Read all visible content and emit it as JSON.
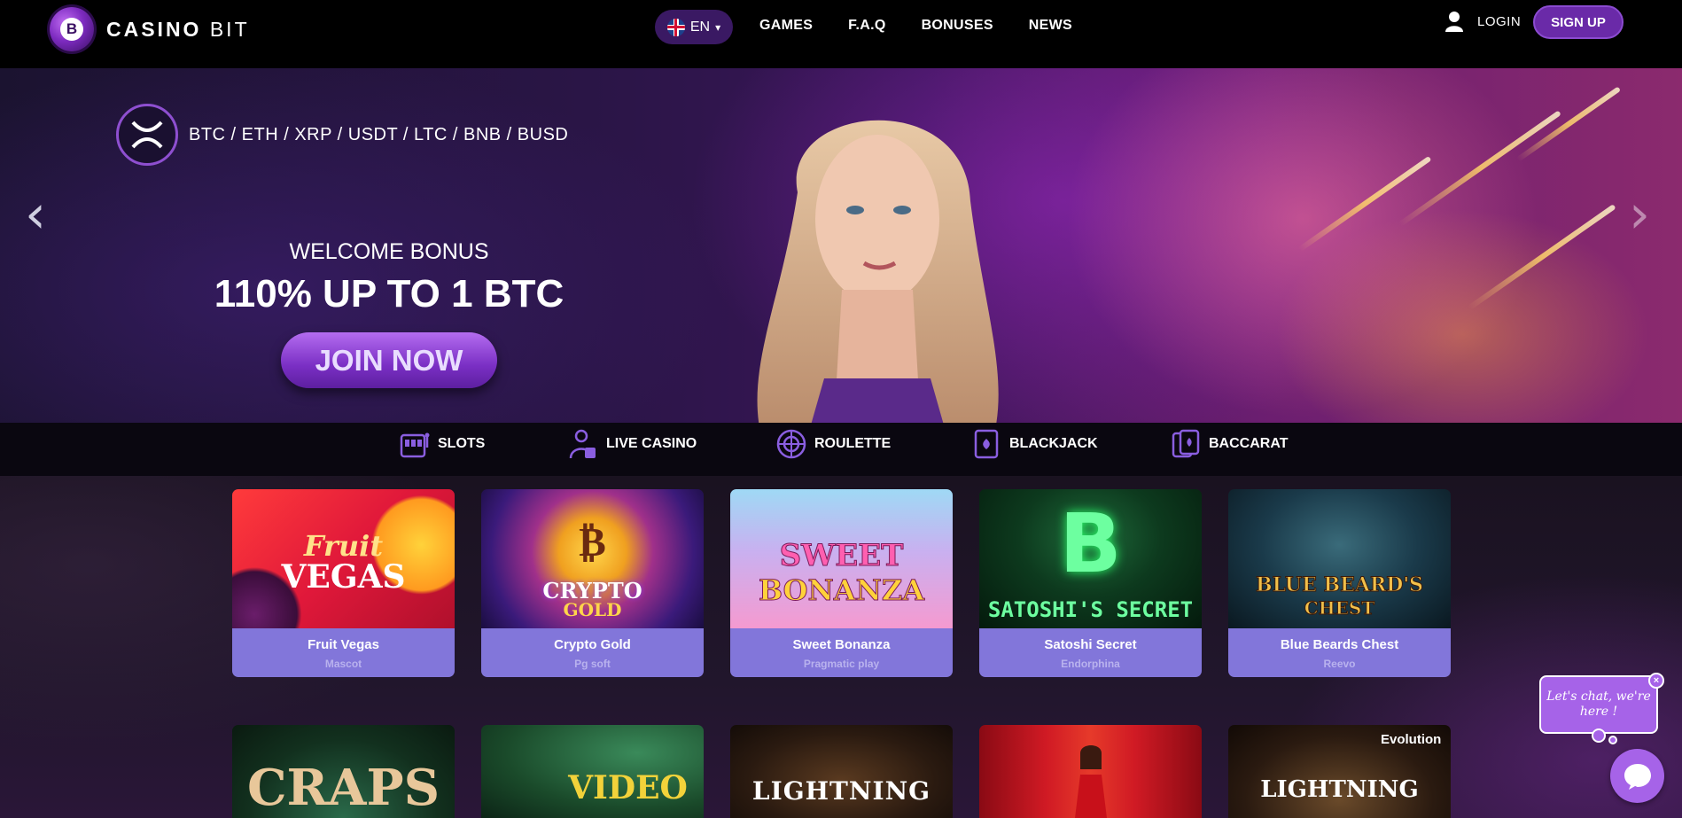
{
  "brand": {
    "name_bold": "CASINO",
    "name_light": "BIT",
    "logo_letter": "B"
  },
  "header": {
    "language": "EN",
    "nav": [
      "GAMES",
      "F.A.Q",
      "BONUSES",
      "NEWS"
    ],
    "login_label": "LOGIN",
    "signup_label": "SIGN UP"
  },
  "hero": {
    "crypto_list": "BTC / ETH / XRP / USDT / LTC / BNB / BUSD",
    "welcome": "WELCOME BONUS",
    "offer": "110% UP TO 1 BTC",
    "cta": "JOIN NOW",
    "prev_arrow": "‹",
    "next_arrow": "›"
  },
  "categories": [
    {
      "label": "SLOTS",
      "icon": "slot-machine-icon"
    },
    {
      "label": "LIVE CASINO",
      "icon": "dealer-icon"
    },
    {
      "label": "ROULETTE",
      "icon": "roulette-icon"
    },
    {
      "label": "BLACKJACK",
      "icon": "card-icon"
    },
    {
      "label": "BACCARAT",
      "icon": "cards-icon"
    }
  ],
  "games": [
    {
      "title": "Fruit Vegas",
      "provider": "Mascot"
    },
    {
      "title": "Crypto Gold",
      "provider": "Pg soft"
    },
    {
      "title": "Sweet Bonanza",
      "provider": "Pragmatic play"
    },
    {
      "title": "Satoshi Secret",
      "provider": "Endorphina"
    },
    {
      "title": "Blue Beards Chest",
      "provider": "Reevo"
    }
  ],
  "games_row2": [
    {
      "art_text": "CRAPS"
    },
    {
      "art_text": "VIDEO"
    },
    {
      "art_text": "LIGHTNING"
    },
    {
      "art_text": ""
    },
    {
      "art_text": "LIGHTNING",
      "badge": "Evolution"
    }
  ],
  "thumbs": {
    "fruit_vegas_a": "Fruit",
    "fruit_vegas_b": "VEGAS",
    "crypto_gold_a": "CRYPTO",
    "crypto_gold_b": "GOLD",
    "sweet_bonanza_a": "SWEET",
    "sweet_bonanza_b": "BONANZA",
    "satoshi": "SATOSHI'S SECRET",
    "bluebeard_a": "BLUE BEARD'S",
    "bluebeard_b": "CHEST"
  },
  "chat": {
    "message": "Let's chat, we're here !",
    "close": "×"
  },
  "colors": {
    "accent": "#6a2aa8",
    "card_info": "#8276da",
    "chat": "#a663e8"
  }
}
